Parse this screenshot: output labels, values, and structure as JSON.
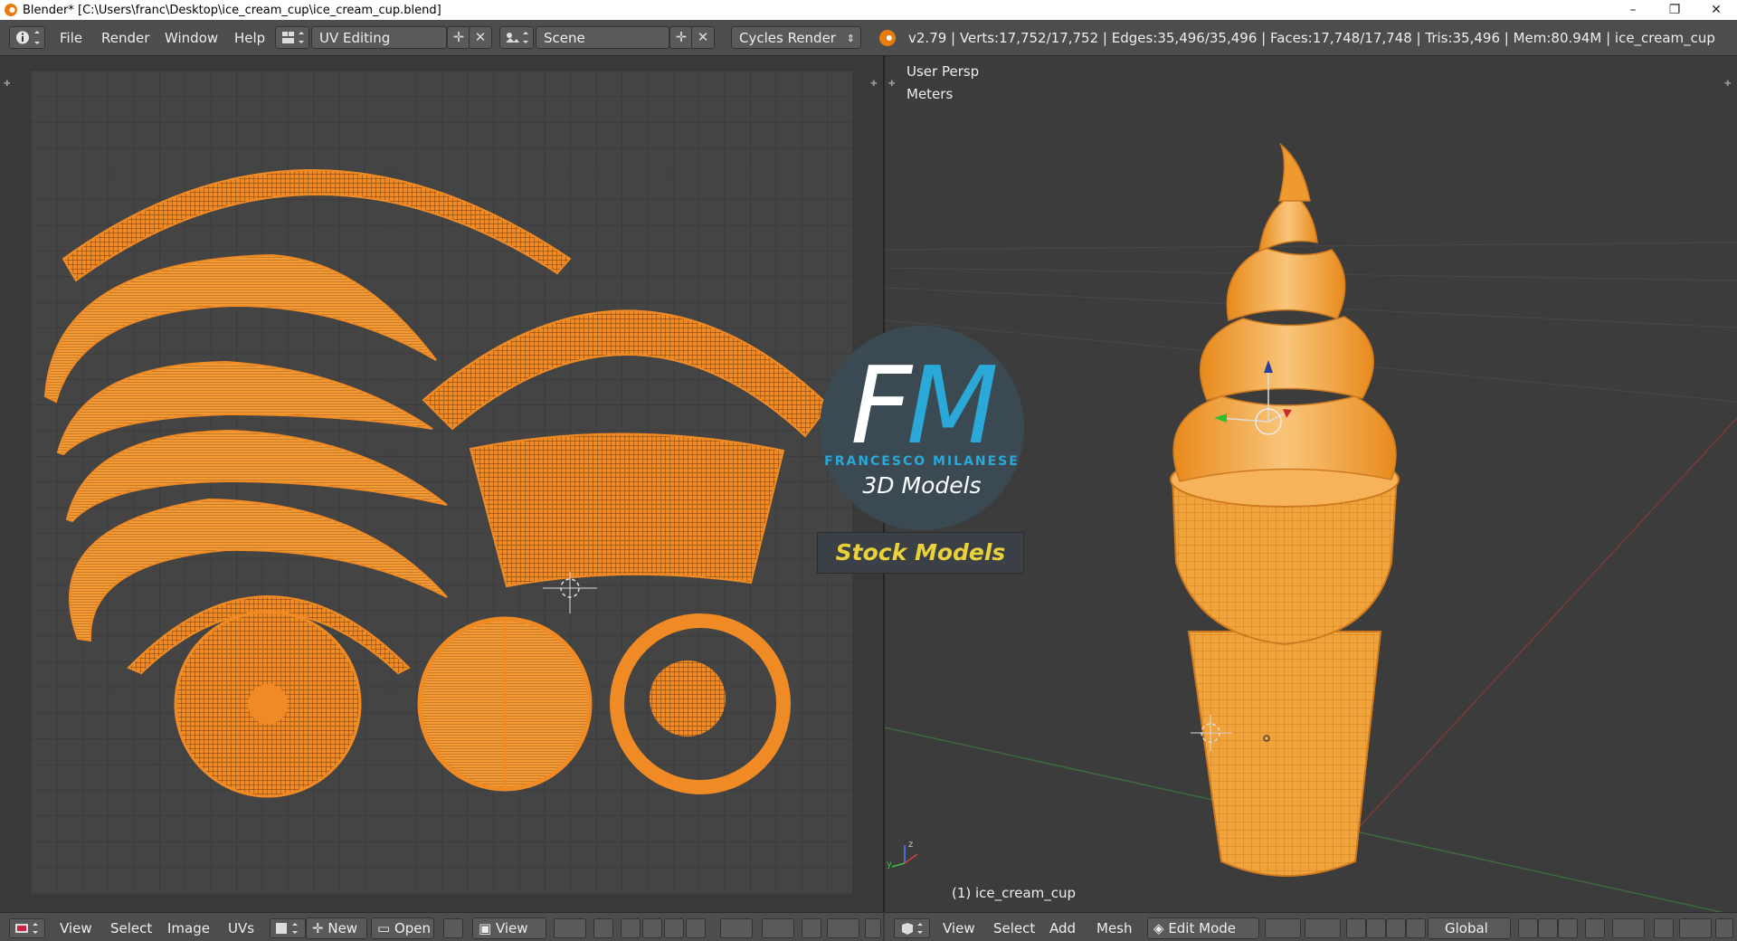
{
  "window": {
    "title": "Blender* [C:\\Users\\franc\\Desktop\\ice_cream_cup\\ice_cream_cup.blend]",
    "controls": [
      "–",
      "❐",
      "✕"
    ]
  },
  "info_header": {
    "menus": [
      "File",
      "Render",
      "Window",
      "Help"
    ],
    "screen_layout": "UV Editing",
    "scene": "Scene",
    "render_engine": "Cycles Render",
    "stats": "v2.79 | Verts:17,752/17,752 | Edges:35,496/35,496 | Faces:17,748/17,748 | Tris:35,496 | Mem:80.94M | ice_cream_cup"
  },
  "uv_editor": {
    "footer": {
      "menus": [
        "View",
        "Select",
        "Image",
        "UVs"
      ],
      "new_label": "New",
      "open_label": "Open",
      "view_label": "View"
    }
  },
  "viewport": {
    "view_name": "User Persp",
    "units": "Meters",
    "object_label": "(1) ice_cream_cup",
    "footer": {
      "menus": [
        "View",
        "Select",
        "Add",
        "Mesh"
      ],
      "mode": "Edit Mode",
      "orientation": "Global"
    }
  },
  "overlay": {
    "logo_f": "F",
    "logo_m": "M",
    "logo_name": "FRANCESCO MILANESE",
    "logo_sub": "3D Models",
    "banner": "Stock Models"
  },
  "colors": {
    "uv_wire": "#f08a24",
    "mesh_fill": "#f5a63c",
    "accent_blue": "#2aa8d8",
    "banner_text": "#e8d13a"
  }
}
